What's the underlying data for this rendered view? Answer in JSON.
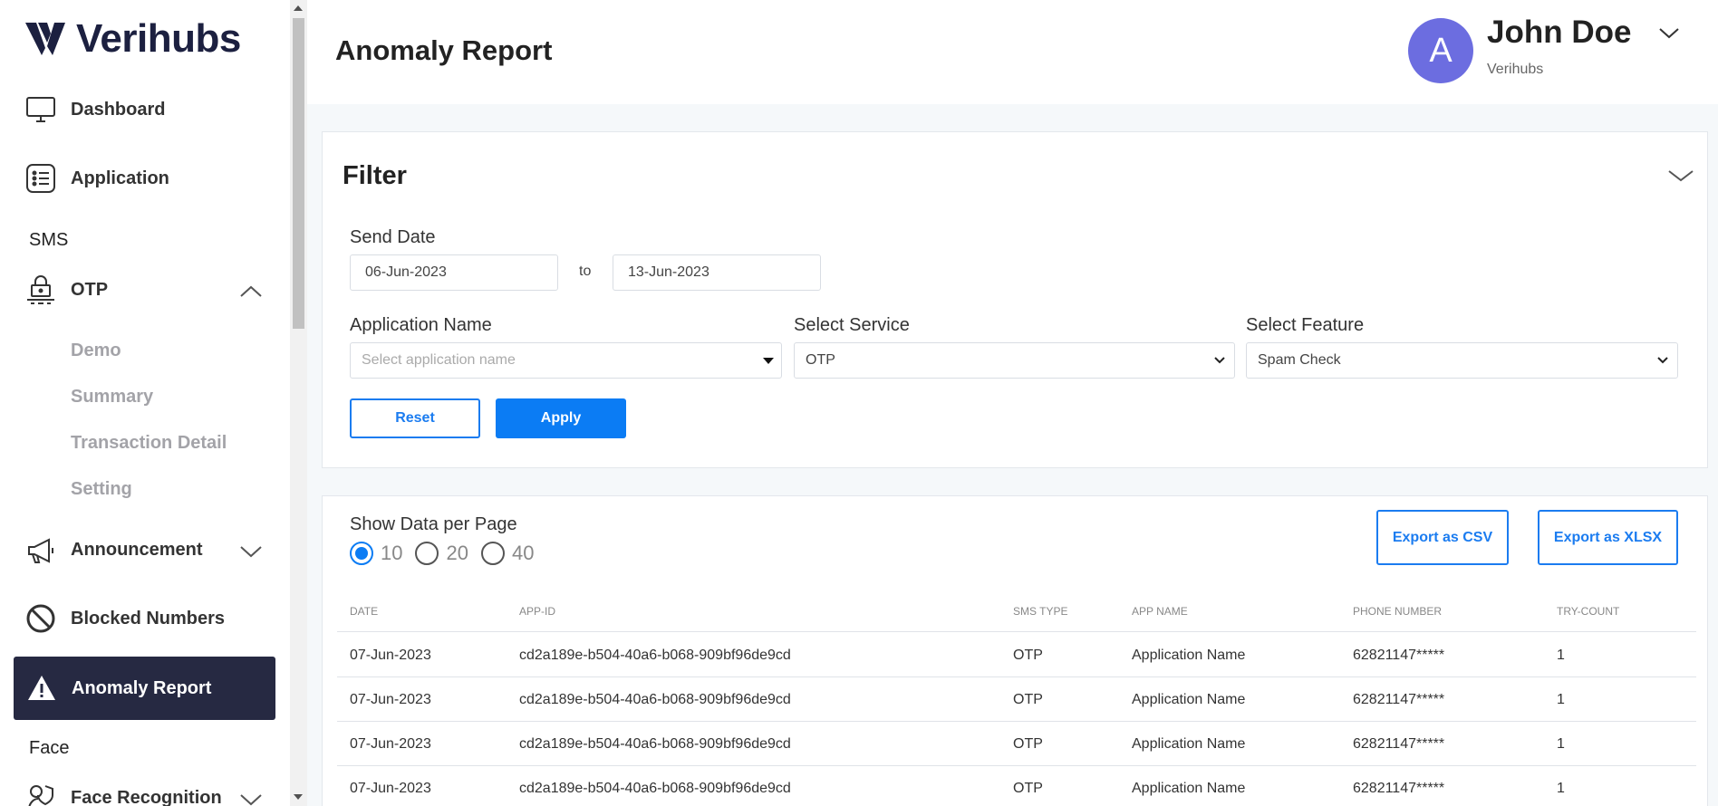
{
  "brand": {
    "name": "Verihubs",
    "color": "#1c2040"
  },
  "sidebar": {
    "items": [
      {
        "label": "Dashboard",
        "icon": "monitor-icon"
      },
      {
        "label": "Application",
        "icon": "list-icon"
      }
    ],
    "sms_section": "SMS",
    "otp": {
      "label": "OTP",
      "icon": "otp-icon",
      "children": [
        "Demo",
        "Summary",
        "Transaction Detail",
        "Setting"
      ]
    },
    "announcement": {
      "label": "Announcement",
      "icon": "megaphone-icon"
    },
    "blocked": {
      "label": "Blocked Numbers",
      "icon": "blocked-icon"
    },
    "active": {
      "label": "Anomaly Report",
      "icon": "warning-icon",
      "bg": "#262942"
    },
    "face_section": "Face",
    "face_recognition": {
      "label": "Face Recognition",
      "icon": "face-shield-icon"
    }
  },
  "header": {
    "title": "Anomaly Report",
    "user": {
      "initial": "A",
      "name": "John Doe",
      "org": "Verihubs",
      "avatar_color": "#6c6de0"
    }
  },
  "filter": {
    "title": "Filter",
    "send_date_label": "Send Date",
    "date_from": "06-Jun-2023",
    "date_to": "13-Jun-2023",
    "to_label": "to",
    "app_name_label": "Application Name",
    "app_name_placeholder": "Select application name",
    "service_label": "Select Service",
    "service_value": "OTP",
    "feature_label": "Select Feature",
    "feature_value": "Spam Check",
    "reset_label": "Reset",
    "apply_label": "Apply",
    "accent": "#0b7cf4"
  },
  "table": {
    "per_page_label": "Show Data per Page",
    "per_page_options": [
      "10",
      "20",
      "40"
    ],
    "per_page_selected": "10",
    "export_csv": "Export as CSV",
    "export_xlsx": "Export as XLSX",
    "columns": [
      "DATE",
      "APP-ID",
      "SMS TYPE",
      "APP NAME",
      "PHONE NUMBER",
      "TRY-COUNT"
    ],
    "rows": [
      [
        "07-Jun-2023",
        "cd2a189e-b504-40a6-b068-909bf96de9cd",
        "OTP",
        "Application Name",
        "62821147*****",
        "1"
      ],
      [
        "07-Jun-2023",
        "cd2a189e-b504-40a6-b068-909bf96de9cd",
        "OTP",
        "Application Name",
        "62821147*****",
        "1"
      ],
      [
        "07-Jun-2023",
        "cd2a189e-b504-40a6-b068-909bf96de9cd",
        "OTP",
        "Application Name",
        "62821147*****",
        "1"
      ],
      [
        "07-Jun-2023",
        "cd2a189e-b504-40a6-b068-909bf96de9cd",
        "OTP",
        "Application Name",
        "62821147*****",
        "1"
      ]
    ]
  }
}
